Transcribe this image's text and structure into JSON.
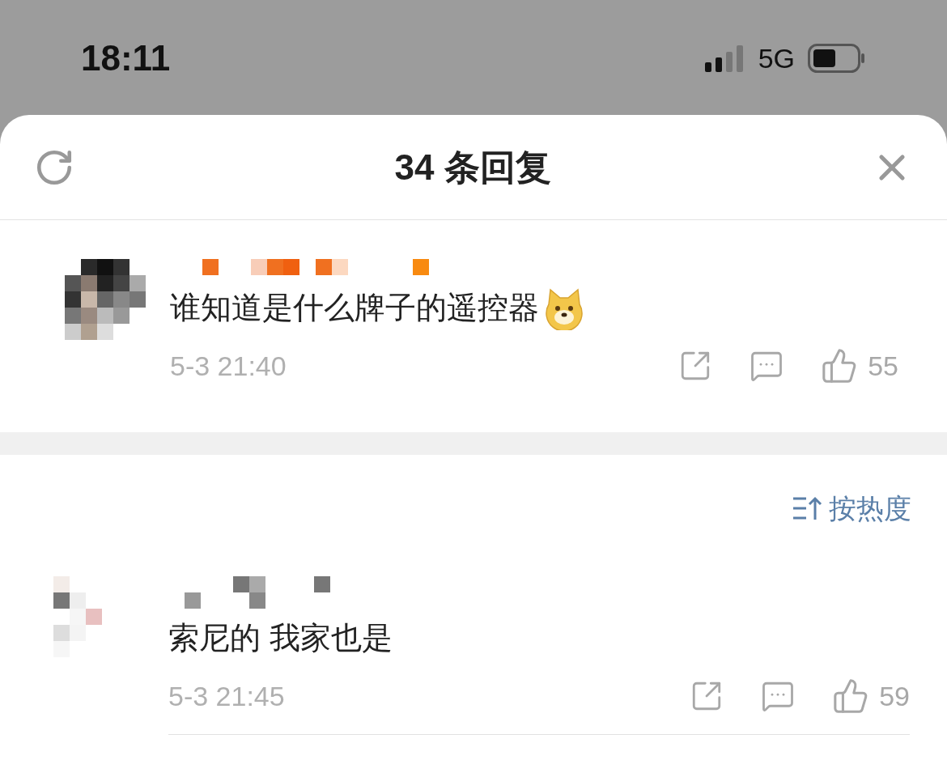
{
  "status_bar": {
    "time": "18:11",
    "network": "5G"
  },
  "header": {
    "title": "34 条回复"
  },
  "main_comment": {
    "text": "谁知道是什么牌子的遥控器",
    "time": "5-3 21:40",
    "likes": "55"
  },
  "sort": {
    "label": "按热度"
  },
  "replies": [
    {
      "text": "索尼的 我家也是",
      "time": "5-3 21:45",
      "likes": "59"
    }
  ]
}
